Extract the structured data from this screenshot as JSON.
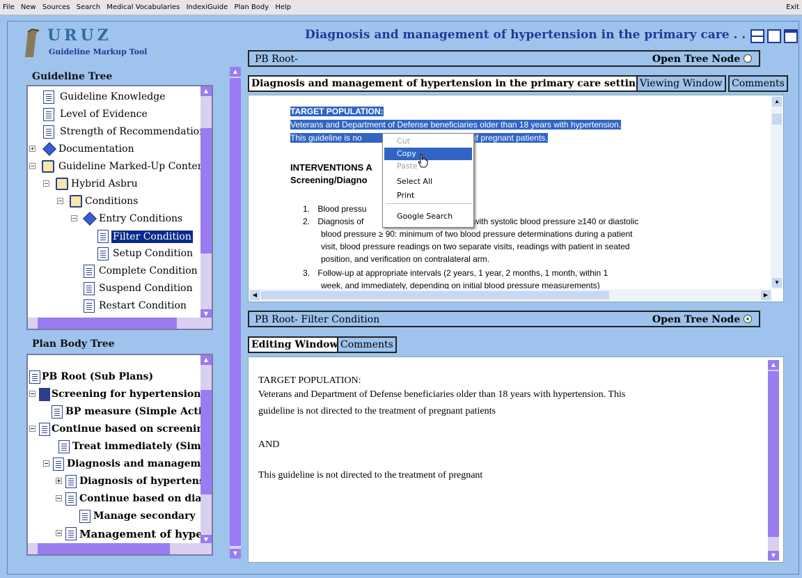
{
  "menubar": {
    "items": [
      "File",
      "New",
      "Sources",
      "Search",
      "Medical Vocabularies",
      "IndexiGuide",
      "Plan Body",
      "Help"
    ],
    "exit": "Exit"
  },
  "logo": {
    "title": "URUZ",
    "subtitle": "Guideline Markup Tool"
  },
  "header": {
    "title": "Diagnosis and management of hypertension in the primary care . . ."
  },
  "guideline_tree": {
    "title": "Guideline Tree",
    "items": [
      "Guideline Knowledge",
      "Level of Evidence",
      "Strength of Recommendation",
      "Documentation",
      "Guideline Marked-Up Content",
      "Hybrid Asbru",
      "Conditions",
      "Entry Conditions",
      "Filter Condition",
      "Setup Condition",
      "Complete Condition",
      "Suspend Condition",
      "Restart Condition"
    ],
    "selected": "Filter Condition"
  },
  "plan_body_tree": {
    "title": "Plan Body Tree",
    "items": [
      "PB Root (Sub Plans)",
      "Screening for hypertension",
      "BP measure (Simple Action)",
      "Continue based on screening",
      "Treat immediately (Simple)",
      "Diagnosis and management",
      "Diagnosis of hypertension",
      "Continue based on diagnosis",
      "Manage secondary",
      "Management of hypertension"
    ]
  },
  "top_panel": {
    "path": "PB Root-",
    "open_tree_node": "Open Tree Node",
    "doc_title": "Diagnosis and management of hypertension in the primary care setting",
    "tab_viewing": "Viewing Window",
    "tab_comments": "Comments",
    "content": {
      "heading": "TARGET POPULATION:",
      "line1": "Veterans and Department of Defense beneficiaries older than 18 years with hypertension.",
      "line2_a": "This guideline is no",
      "line2_b": "tment of pregnant patients.",
      "interventions": "INTERVENTIONS A",
      "screening": "Screening/Diagno",
      "list": [
        {
          "num": "1.",
          "text": "Blood pressu"
        },
        {
          "num": "2.",
          "text_a": "Diagnosis of",
          "text_b": "atients with systolic blood pressure ≥140 or diastolic"
        },
        {
          "num": "",
          "text": "blood pressure ≥ 90: minimum of two blood pressure determinations during a patient"
        },
        {
          "num": "",
          "text": "visit, blood pressure readings on two separate visits, readings with patient in seated"
        },
        {
          "num": "",
          "text": "position, and verification on contralateral arm."
        },
        {
          "num": "3.",
          "text": "Follow-up at appropriate intervals (2 years, 1 year, 2 months, 1 month, within 1"
        },
        {
          "num": "",
          "text": "week, and immediately, depending on initial blood pressure measurements)"
        }
      ]
    },
    "context_menu": [
      "Cut",
      "Copy",
      "Paste",
      "Select All",
      "Print",
      "Google Search"
    ]
  },
  "bottom_panel": {
    "path": "PB Root- Filter Condition",
    "open_tree_node": "Open Tree Node",
    "tab_editing": "Editing Window",
    "tab_comments": "Comments",
    "content": {
      "p1": "TARGET POPULATION:",
      "p2": "Veterans and Department of Defense beneficiaries older than 18 years with hypertension. This",
      "p3": "guideline is not directed to the treatment of pregnant patients",
      "p4": "AND",
      "p5": "This guideline is not directed to the treatment of pregnant"
    }
  }
}
